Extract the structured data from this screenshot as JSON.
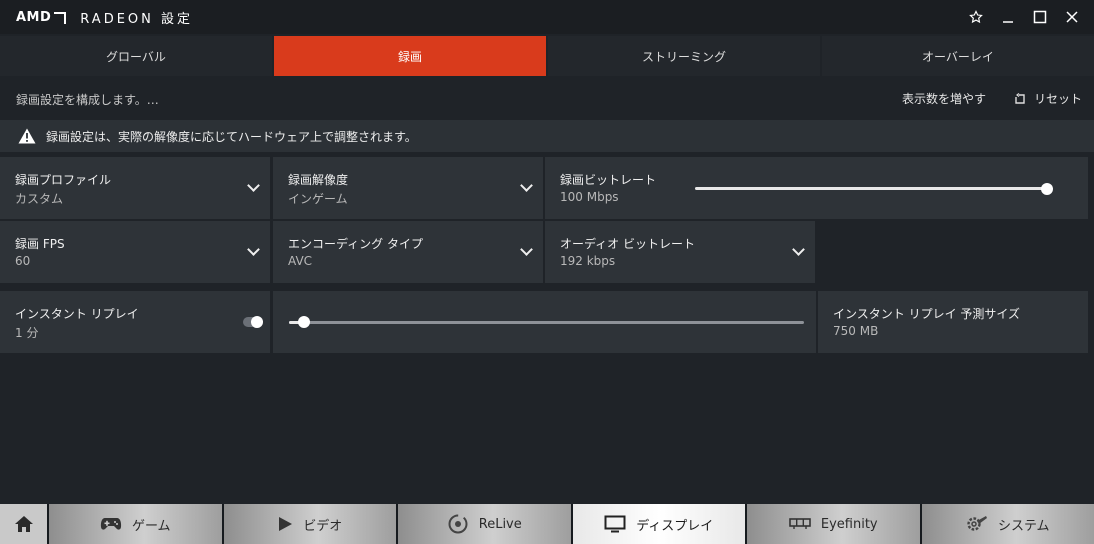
{
  "titlebar": {
    "brand": "AMD",
    "app_title": "RADEON 設定",
    "icons": [
      "star-icon",
      "minimize-icon",
      "maximize-icon",
      "close-icon"
    ]
  },
  "tabs": [
    {
      "label": "グローバル",
      "active": false
    },
    {
      "label": "録画",
      "active": true
    },
    {
      "label": "ストリーミング",
      "active": false
    },
    {
      "label": "オーバーレイ",
      "active": false
    }
  ],
  "info": {
    "description": "録画設定を構成します。…",
    "show_more": "表示数を増やす",
    "reset": "リセット"
  },
  "warning": {
    "text": "録画設定は、実際の解像度に応じてハードウェア上で調整されます。"
  },
  "settings": {
    "profile": {
      "label": "録画プロファイル",
      "value": "カスタム"
    },
    "resolution": {
      "label": "録画解像度",
      "value": "インゲーム"
    },
    "bitrate": {
      "label": "録画ビットレート",
      "value": "100 Mbps",
      "slider_fraction": 1.0
    },
    "fps": {
      "label": "録画 FPS",
      "value": "60"
    },
    "encoding": {
      "label": "エンコーディング タイプ",
      "value": "AVC"
    },
    "audio_bitrate": {
      "label": "オーディオ ビットレート",
      "value": "192 kbps"
    },
    "instant_replay": {
      "label": "インスタント リプレイ",
      "value": "1 分",
      "toggle_on": true,
      "slider_fraction": 0.03
    },
    "replay_size": {
      "label": "インスタント リプレイ 予測サイズ",
      "value": "750 MB"
    }
  },
  "bottomnav": {
    "items": [
      {
        "label": "ゲーム",
        "icon": "gamepad-icon",
        "active": false
      },
      {
        "label": "ビデオ",
        "icon": "play-icon",
        "active": false
      },
      {
        "label": "ReLive",
        "icon": "relive-icon",
        "active": false
      },
      {
        "label": "ディスプレイ",
        "icon": "monitor-icon",
        "active": true
      },
      {
        "label": "Eyefinity",
        "icon": "eyefinity-icon",
        "active": false
      },
      {
        "label": "システム",
        "icon": "gear-wrench-icon",
        "active": false
      }
    ]
  },
  "colors": {
    "accent": "#d93b1c",
    "background": "#1f2328",
    "card": "#2e3338"
  }
}
